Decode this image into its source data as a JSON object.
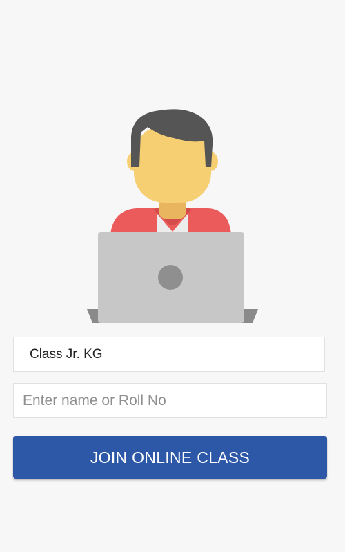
{
  "illustration": {
    "icon": "student-with-laptop-icon"
  },
  "class_info": {
    "label": "Class Jr. KG"
  },
  "name_field": {
    "value": "",
    "placeholder": "Enter name or Roll No"
  },
  "join_button": {
    "label": "JOIN ONLINE CLASS"
  },
  "colors": {
    "background": "#f7f7f7",
    "button": "#2c58a7",
    "hair": "#555555",
    "skin": "#f6cf72",
    "shirt": "#ec5b5b",
    "laptop": "#c7c7c7"
  }
}
